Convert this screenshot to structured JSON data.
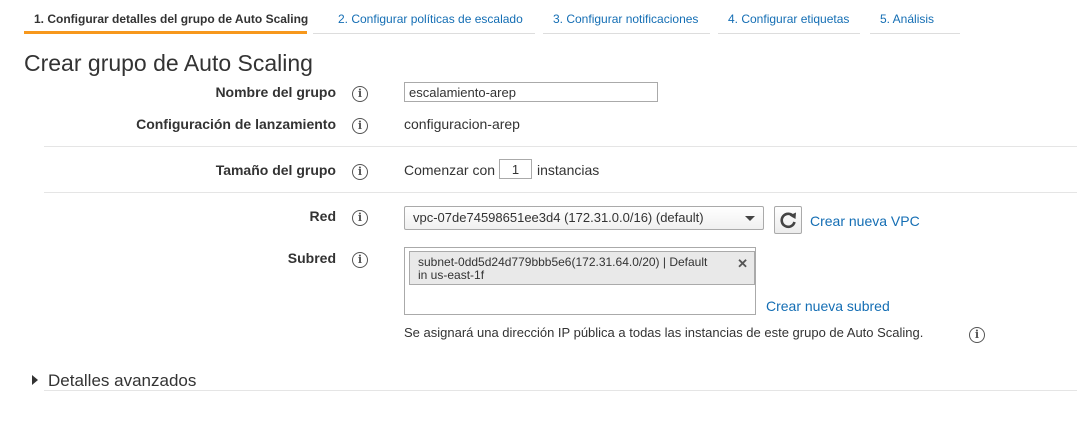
{
  "wizard": {
    "steps": [
      {
        "label": "1. Configurar detalles del grupo de Auto Scaling",
        "active": true
      },
      {
        "label": "2. Configurar políticas de escalado",
        "active": false
      },
      {
        "label": "3. Configurar notificaciones",
        "active": false
      },
      {
        "label": "4. Configurar etiquetas",
        "active": false
      },
      {
        "label": "5. Análisis",
        "active": false
      }
    ]
  },
  "page": {
    "title": "Crear grupo de Auto Scaling"
  },
  "form": {
    "group_name": {
      "label": "Nombre del grupo",
      "value": "escalamiento-arep"
    },
    "launch_config": {
      "label": "Configuración de lanzamiento",
      "value": "configuracion-arep"
    },
    "group_size": {
      "label": "Tamaño del grupo",
      "prefix": "Comenzar con",
      "value": "1",
      "suffix": "instancias"
    },
    "network": {
      "label": "Red",
      "selected": "vpc-07de74598651ee3d4 (172.31.0.0/16) (default)",
      "create_link": "Crear nueva VPC"
    },
    "subnet": {
      "label": "Subred",
      "chip_line1": "subnet-0dd5d24d779bbb5e6(172.31.64.0/20) | Default",
      "chip_line2": "in us-east-1f",
      "create_link": "Crear nueva subred",
      "note": "Se asignará una dirección IP pública a todas las instancias de este grupo de Auto Scaling."
    }
  },
  "advanced": {
    "label": "Detalles avanzados"
  },
  "colors": {
    "link": "#146eb4",
    "active_tab_underline": "#f7981d",
    "text": "#333333"
  }
}
